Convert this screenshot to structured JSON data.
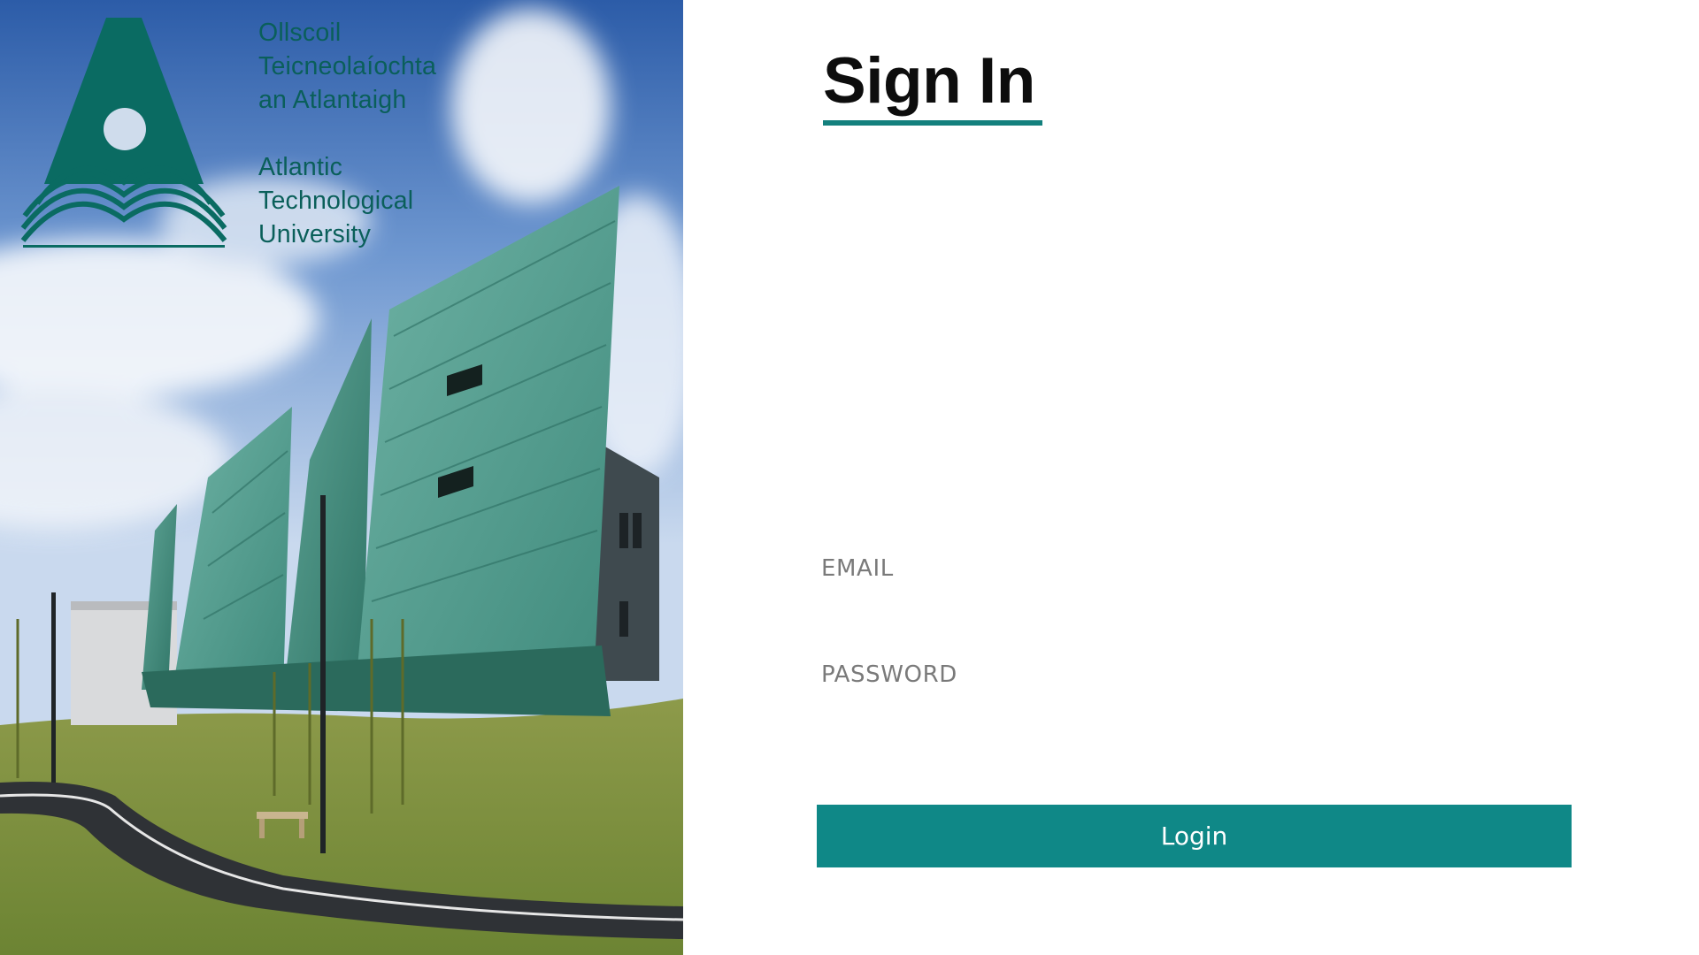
{
  "brand": {
    "name_irish": [
      "Ollscoil",
      "Teicneolaíochta",
      "an Atlantaigh"
    ],
    "name_english": [
      "Atlantic",
      "Technological",
      "University"
    ],
    "logo_icon": "atu-triangle-logo",
    "color": "#0a5f5a"
  },
  "hero": {
    "image": "campus-building-photo"
  },
  "form": {
    "title": "Sign In",
    "accent_color": "#13807d",
    "email_label": "EMAIL",
    "email_value": "",
    "password_label": "PASSWORD",
    "password_value": "",
    "login_label": "Login",
    "button_color": "#0f8887"
  }
}
